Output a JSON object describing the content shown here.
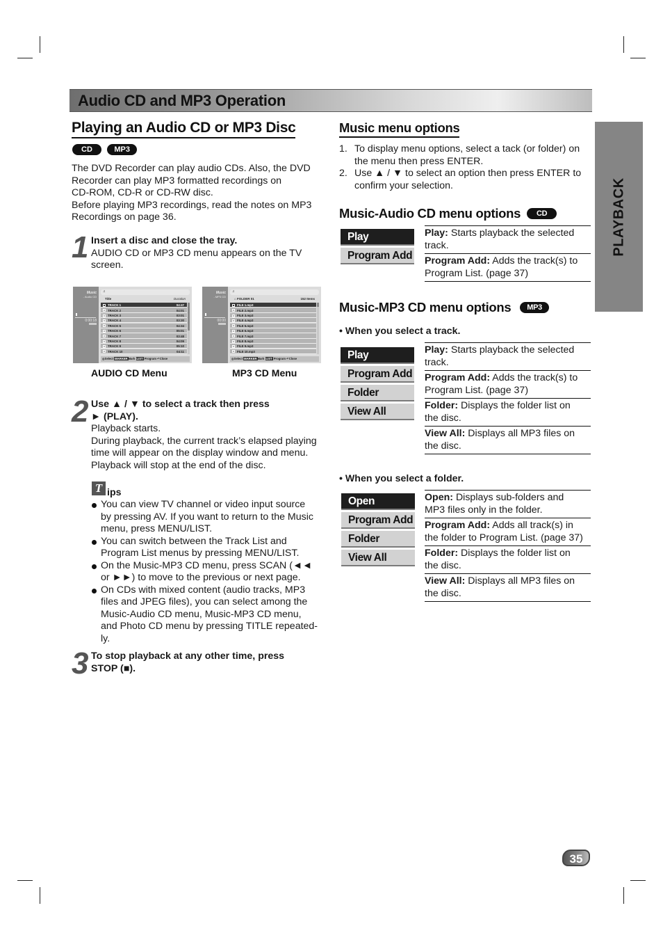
{
  "header": {
    "title": "Audio CD and MP3 Operation"
  },
  "side_tab": {
    "label": "PLAYBACK"
  },
  "left": {
    "title": "Playing an Audio CD or MP3 Disc",
    "badges": [
      "CD",
      "MP3"
    ],
    "intro": [
      "The DVD Recorder can play audio CDs. Also, the DVD",
      "Recorder can play MP3 formatted recordings on",
      "CD-ROM, CD-R or CD-RW disc.",
      "Before playing MP3 recordings, read the notes on MP3",
      "Recordings on page 36."
    ],
    "step1": {
      "number": "1",
      "heading": "Insert a disc and close the tray.",
      "text_line1": "AUDIO CD or MP3 CD menu appears on the TV",
      "text_line2": "screen."
    },
    "audio_cd_screen": {
      "caption": "AUDIO CD Menu",
      "side_title": "Music",
      "side_subtitle": "- Audio CD",
      "elapsed": "0:00:18",
      "top_icon": "♫",
      "col_title": "Title",
      "col_duration": "Duration",
      "rows": [
        {
          "name": "TRACK 1",
          "duration": "04:47",
          "selected": true
        },
        {
          "name": "TRACK 2",
          "duration": "04:01"
        },
        {
          "name": "TRACK 3",
          "duration": "03:01"
        },
        {
          "name": "TRACK 4",
          "duration": "03:30"
        },
        {
          "name": "TRACK 5",
          "duration": "04:34"
        },
        {
          "name": "TRACK 6",
          "duration": "05:01"
        },
        {
          "name": "TRACK 7",
          "duration": "03:48"
        },
        {
          "name": "TRACK 8",
          "duration": "04:09"
        },
        {
          "name": "TRACK 9",
          "duration": "05:10"
        },
        {
          "name": "TRACK 10",
          "duration": "04:11"
        }
      ],
      "footer": {
        "select": "Select",
        "marker_key": "MARKER",
        "mark": "Mark",
        "list_key": "LIST",
        "program": "Program",
        "close": "Close"
      }
    },
    "mp3_cd_screen": {
      "caption": "MP3 CD Menu",
      "side_title": "Music",
      "side_subtitle": "- MP3 CD",
      "elapsed": "00:00",
      "top_icon": "♫",
      "folder_name": "FOLDER 01",
      "item_count": "152 Items",
      "rows": [
        {
          "name": "FILE 1.mp3",
          "selected": true
        },
        {
          "name": "FILE 2.mp3"
        },
        {
          "name": "FILE 3.mp3"
        },
        {
          "name": "FILE 4.mp3"
        },
        {
          "name": "FILE 5.mp3"
        },
        {
          "name": "FILE 6.mp3"
        },
        {
          "name": "FILE 7.mp3"
        },
        {
          "name": "FILE 8.mp3"
        },
        {
          "name": "FILE 9.mp3"
        },
        {
          "name": "FILE 10.mp3"
        }
      ],
      "footer": {
        "select": "Select",
        "marker_key": "MARKER",
        "mark": "Mark",
        "list_key": "LIST",
        "program": "Program",
        "close": "Close"
      }
    },
    "step2": {
      "number": "2",
      "heading_line1": "Use ▲ / ▼ to select a track then press",
      "heading_line2": "► (PLAY).",
      "text": [
        "Playback starts.",
        "During playback, the current track’s elapsed playing",
        "time will appear on the display window and menu.",
        "Playback will stop at the end of the disc."
      ]
    },
    "tips": {
      "icon_letter": "T",
      "label": "ips",
      "items": [
        [
          "You can view TV channel or video input source",
          "by pressing AV. If you want to return to the Music",
          "menu, press MENU/LIST."
        ],
        [
          "You can switch between the Track List and",
          "Program List menus by pressing MENU/LIST."
        ],
        [
          "On the Music-MP3 CD menu, press SCAN (◄◄",
          "or ►►) to move to the previous or next page."
        ],
        [
          "On CDs with mixed content (audio tracks, MP3",
          "files and JPEG files), you can select among the",
          "Music-Audio CD menu, Music-MP3 CD menu,",
          "and Photo CD menu by pressing TITLE repeated-",
          "ly."
        ]
      ]
    },
    "step3": {
      "number": "3",
      "heading_line1": "To stop playback at any other time, press",
      "heading_line2": "STOP (■)."
    }
  },
  "right": {
    "music_menu": {
      "title": "Music menu options",
      "steps": [
        {
          "num": "1.",
          "lines": [
            "To display menu options, select a tack (or folder) on",
            "the menu then press ENTER."
          ]
        },
        {
          "num": "2.",
          "lines": [
            "Use ▲ / ▼ to select an option then press ENTER to",
            "confirm your selection."
          ]
        }
      ]
    },
    "audio_cd_options": {
      "title": "Music-Audio CD menu options",
      "badge": "CD",
      "menu": [
        "Play",
        "Program Add"
      ],
      "descriptions": [
        {
          "term": "Play:",
          "lines": [
            "Starts playback the selected",
            "track."
          ]
        },
        {
          "term": "Program Add:",
          "lines": [
            "Adds the track(s) to",
            "Program List. (page 37)"
          ]
        }
      ]
    },
    "mp3_cd_options": {
      "title": "Music-MP3 CD menu options",
      "badge": "MP3",
      "track_heading": "•  When you select a track.",
      "track_menu": [
        "Play",
        "Program Add",
        "Folder",
        "View All"
      ],
      "track_descriptions": [
        {
          "term": "Play:",
          "lines": [
            "Starts playback the selected",
            "track."
          ]
        },
        {
          "term": "Program Add:",
          "lines": [
            "Adds the track(s) to",
            "Program List. (page 37)"
          ]
        },
        {
          "term": "Folder:",
          "lines": [
            "Displays the folder list on",
            "the disc."
          ]
        },
        {
          "term": "View All:",
          "lines": [
            "Displays all MP3 files on",
            "the disc."
          ]
        }
      ],
      "folder_heading": "•  When you select a folder.",
      "folder_menu": [
        "Open",
        "Program Add",
        "Folder",
        "View All"
      ],
      "folder_descriptions": [
        {
          "term": "Open:",
          "lines": [
            "Displays sub-folders and",
            "MP3 files only in the folder."
          ]
        },
        {
          "term": "Program Add:",
          "lines": [
            "Adds all track(s) in",
            "the folder to Program List. (page 37)"
          ]
        },
        {
          "term": "Folder:",
          "lines": [
            "Displays the folder list on",
            "the disc."
          ]
        },
        {
          "term": "View All:",
          "lines": [
            "Displays all MP3 files on",
            "the disc."
          ]
        }
      ]
    }
  },
  "page_number": "35"
}
